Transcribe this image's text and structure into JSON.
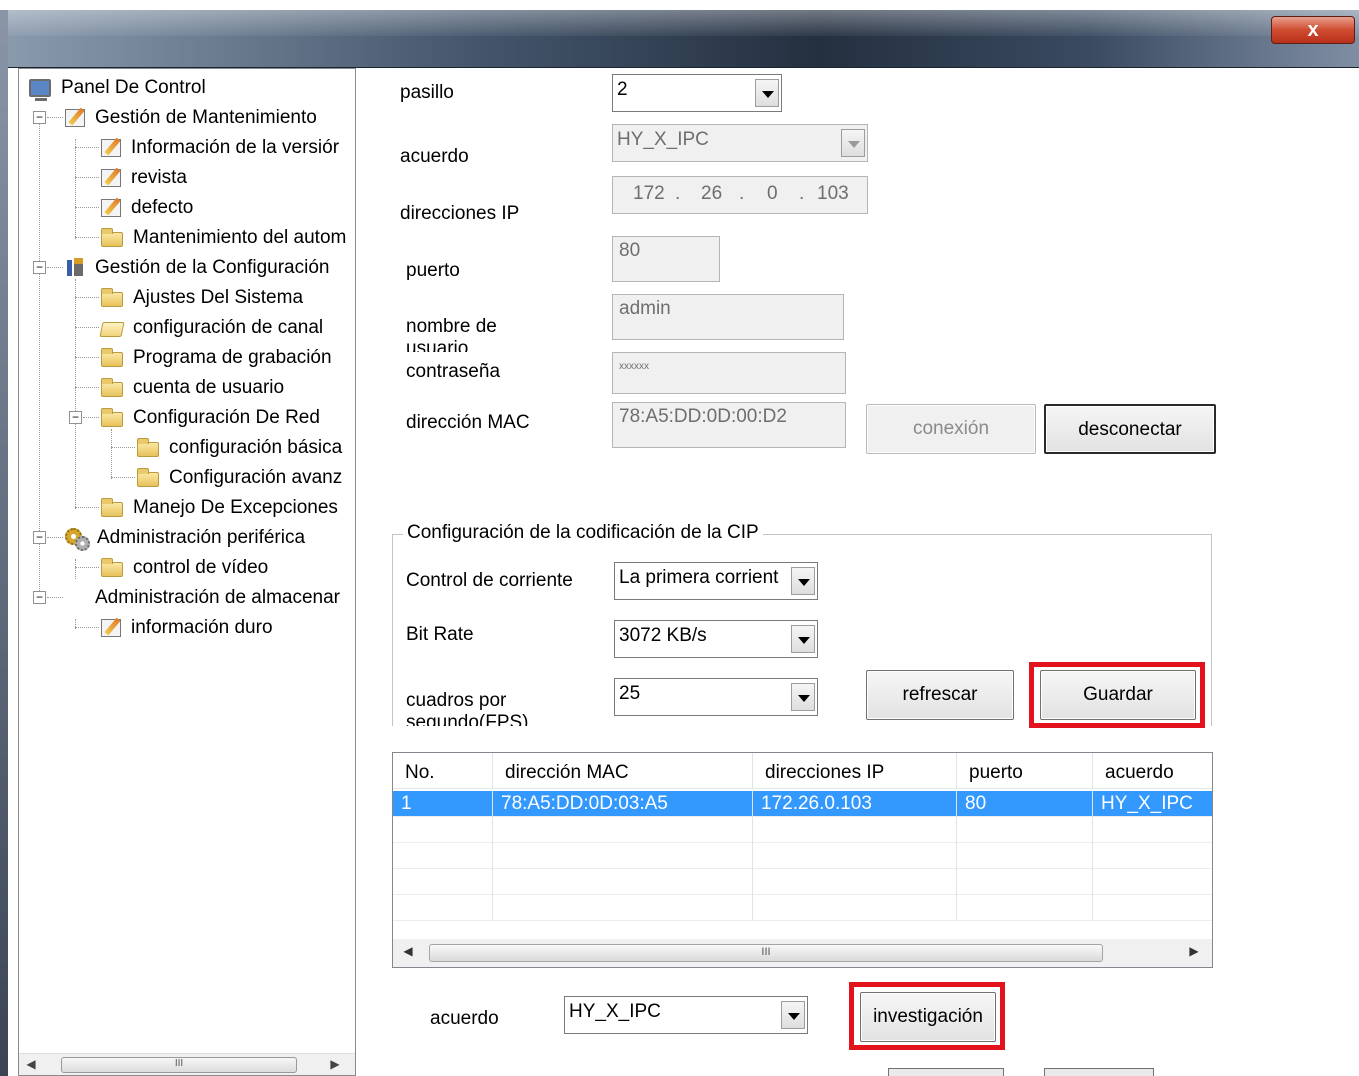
{
  "window": {
    "close_label": "x"
  },
  "tree": {
    "root": "Panel De Control",
    "maintenance": "Gestión de Mantenimiento",
    "version_info": "Información de la versiór",
    "review": "revista",
    "default": "defecto",
    "auto_maintenance": "Mantenimiento del autom",
    "config_mgmt": "Gestión de la Configuración",
    "system_settings": "Ajustes Del Sistema",
    "channel_config": "configuración de canal",
    "record_schedule": "Programa de grabación",
    "user_account": "cuenta de usuario",
    "network_config": "Configuración De Red",
    "basic_config": "configuración básica",
    "advanced_config": "Configuración avanz",
    "exceptions": "Manejo De Excepciones",
    "peripheral": "Administración periférica",
    "video_control": "control de vídeo",
    "storage": "Administración de almacenar",
    "disk_info": "información duro",
    "scroll_grip": "III"
  },
  "form": {
    "channel_label": "pasillo",
    "channel_value": "2",
    "protocol_label": "acuerdo",
    "protocol_value": "HY_X_IPC",
    "ip_label": "direcciones IP",
    "ip": [
      "172",
      "26",
      "0",
      "103"
    ],
    "ip_sep": ".",
    "port_label": "puerto",
    "port_value": "80",
    "user_label_1": "nombre de",
    "user_label_2": "usuario",
    "user_value": "admin",
    "password_label": "contraseña",
    "password_value": "xxxxxx",
    "mac_label": "dirección MAC",
    "mac_value": "78:A5:DD:0D:00:D2",
    "connect_button": "conexión",
    "disconnect_button": "desconectar"
  },
  "encoding": {
    "title": "Configuración de la codificación de la CIP",
    "stream_label": "Control de corriente",
    "stream_value": "La primera corrient",
    "bitrate_label": "Bit Rate",
    "bitrate_value": "3072 KB/s",
    "fps_label_1": "cuadros por",
    "fps_label_2": "segundo(FPS)",
    "fps_value": "25",
    "refresh_button": "refrescar",
    "save_button": "Guardar"
  },
  "table": {
    "columns": [
      "No.",
      "dirección MAC",
      "direcciones IP",
      "puerto",
      "acuerdo"
    ],
    "rows": [
      [
        "1",
        "78:A5:DD:0D:03:A5",
        "172.26.0.103",
        "80",
        "HY_X_IPC"
      ]
    ],
    "scroll_grip": "III"
  },
  "search": {
    "protocol_label": "acuerdo",
    "protocol_value": "HY_X_IPC",
    "search_button": "investigación"
  },
  "colors": {
    "highlight": "#e3131e",
    "selection": "#3399ff"
  }
}
